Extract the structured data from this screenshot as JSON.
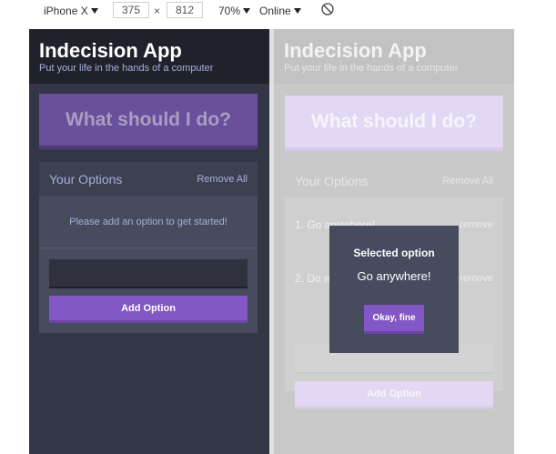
{
  "toolbar": {
    "device": "iPhone X",
    "width": "375",
    "times": "×",
    "height": "812",
    "zoom": "70%",
    "network": "Online",
    "rotate_icon": "rotate-icon"
  },
  "app": {
    "title": "Indecision App",
    "subtitle": "Put your life in the hands of a computer",
    "action_button": "What should I do?",
    "options_title": "Your Options",
    "remove_all": "Remove All",
    "empty_message": "Please add an option to get started!",
    "add_button": "Add Option",
    "input_value": ""
  },
  "right_app": {
    "options": [
      {
        "text": "1. Go anywhere!",
        "remove": "remove"
      },
      {
        "text": "2. Do e",
        "remove": "remove"
      }
    ]
  },
  "modal": {
    "title": "Selected option",
    "body": "Go anywhere!",
    "button": "Okay, fine"
  },
  "colors": {
    "header_dark": "#20222b",
    "background": "#333745",
    "accent": "#8357c5",
    "widget": "#464b5e",
    "muted_text": "#a5afd7"
  }
}
